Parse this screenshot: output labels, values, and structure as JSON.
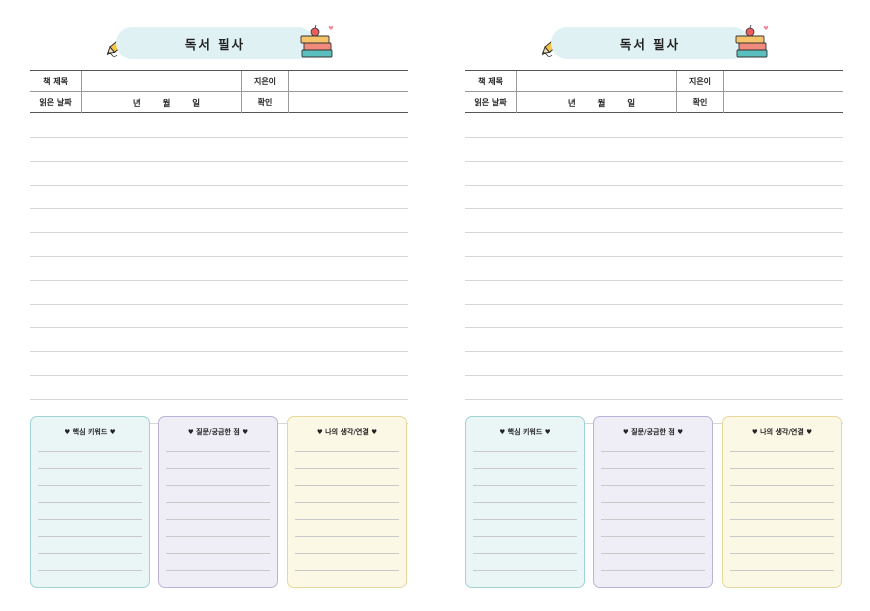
{
  "pages": [
    {
      "title": "독서 필사",
      "info": {
        "book_title_label": "책 제목",
        "author_label": "지은이",
        "date_label": "읽은 날짜",
        "year_label": "년",
        "month_label": "월",
        "day_label": "일",
        "confirm_label": "확인"
      },
      "boxes": [
        {
          "title": "핵심 키워드"
        },
        {
          "title": "질문/궁금한 점"
        },
        {
          "title": "나의 생각/연결"
        }
      ]
    },
    {
      "title": "독서 필사",
      "info": {
        "book_title_label": "책 제목",
        "author_label": "지은이",
        "date_label": "읽은 날짜",
        "year_label": "년",
        "month_label": "월",
        "day_label": "일",
        "confirm_label": "확인"
      },
      "boxes": [
        {
          "title": "핵심 키워드"
        },
        {
          "title": "질문/궁금한 점"
        },
        {
          "title": "나의 생각/연결"
        }
      ]
    }
  ],
  "heart_glyph": "♥",
  "icons": [
    "pencil-icon",
    "books-icon",
    "heart-icon"
  ],
  "colors": {
    "banner": "#dff1f3",
    "box_keyword": "#eaf6f6",
    "box_question": "#efedf6",
    "box_thought": "#fcf8e6"
  }
}
